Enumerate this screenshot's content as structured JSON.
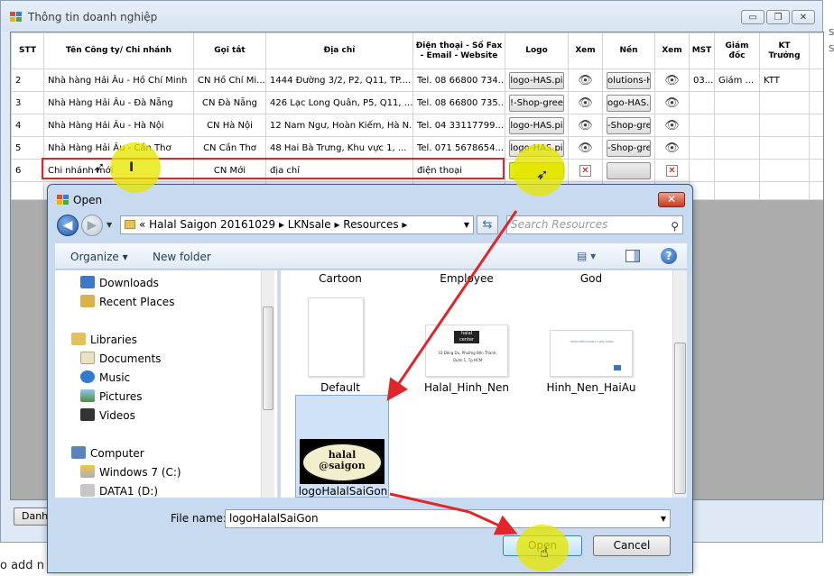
{
  "main": {
    "title": "Thông tin doanh nghiệp",
    "win_buttons": [
      "▭",
      "❐",
      "✕"
    ],
    "columns": [
      "STT",
      "Tên Công ty/ Chi nhánh",
      "Gọi tắt",
      "Địa chỉ",
      "Điện thoại - Số Fax - Email - Website",
      "Logo",
      "Xem",
      "Nền",
      "Xem",
      "MST",
      "Giám đốc",
      "KT Trưởng"
    ],
    "rows": [
      {
        "stt": "2",
        "name": "Nhà hàng Hải Âu - Hồ Chí Minh",
        "short": "CN Hồ Chí Mi...",
        "address": "1444 Đường 3/2, P2, Q11, TP....",
        "phone": "Tel. 08 66800 734...",
        "logo": "logo-HAS.pi",
        "bg": "olutions-H/",
        "mst": "03...",
        "director": "Giám ...",
        "accountant": "KTT"
      },
      {
        "stt": "3",
        "name": "Nhà Hàng Hải Âu - Đà Nẵng",
        "short": "CN Đà Nẵng",
        "address": "426 Lạc Long Quân, P5, Q11, ...",
        "phone": "Tel. 08 66800 735...",
        "logo": "!-Shop-gree",
        "bg": "ogo-HAS.p",
        "mst": "",
        "director": "",
        "accountant": ""
      },
      {
        "stt": "4",
        "name": "Nhà Hàng Hải Âu - Hà Nội",
        "short": "CN Hà Nội",
        "address": "12 Nam Ngư, Hoàn Kiếm, Hà N...",
        "phone": "Tel. 04 33117799...",
        "logo": "logo-HAS.pi",
        "bg": "-Shop-gre",
        "mst": "",
        "director": "",
        "accountant": ""
      },
      {
        "stt": "5",
        "name": "Nhà Hàng Hải Âu - Cần Thơ",
        "short": "CN Cần Thơ",
        "address": "48 Hai Bà Trưng, Khu vực 1, ...",
        "phone": "Tel. 071 5678654...",
        "logo": "logo-HAS.pi",
        "bg": "-Shop-gre",
        "mst": "",
        "director": "",
        "accountant": ""
      },
      {
        "stt": "6",
        "name": "Chi nhánh mới",
        "short": "CN Mới",
        "address": "địa chỉ",
        "phone": "điện thoại",
        "logo": "",
        "bg": "",
        "mst": "",
        "director": "",
        "accountant": ""
      }
    ],
    "bottom_button": "Danh",
    "caption": "o add n",
    "stray_right": [
      "S",
      "S"
    ]
  },
  "dialog": {
    "title": "Open",
    "breadcrumb": "«  Halal Saigon 20161029  ▸  LKNsale  ▸  Resources  ▸",
    "search_placeholder": "Search Resources",
    "organize": "Organize ▾",
    "new_folder": "New folder",
    "nav": [
      "Downloads",
      "Recent Places",
      "Libraries",
      "Documents",
      "Music",
      "Pictures",
      "Videos",
      "Computer",
      "Windows 7 (C:)",
      "DATA1 (D:)"
    ],
    "files_top": [
      "Cartoon",
      "Employee",
      "God"
    ],
    "files": [
      "Default",
      "Halal_Hinh_Nen",
      "Hinh_Nen_HaiAu",
      "logoHalalSaiGon"
    ],
    "thumb_text": {
      "halal_name": "halal center",
      "halal_address": "33 Đông Du, Phường Bến Thành,",
      "halal_city": "Quận 1, Tp.HCM",
      "haiau_heading": "PHẦN MỀM QUẢN LÝ NHÀ HÀNG",
      "logo_line1": "halal",
      "logo_line2": "@saigon"
    },
    "file_name_label": "File name:",
    "file_name_value": "logoHalalSaiGon",
    "open_label": "Open",
    "cancel_label": "Cancel"
  },
  "colors": {
    "highlight": "#e6e600",
    "annotation_red": "#e0262b",
    "dialog_frame": "#c8daf0"
  }
}
